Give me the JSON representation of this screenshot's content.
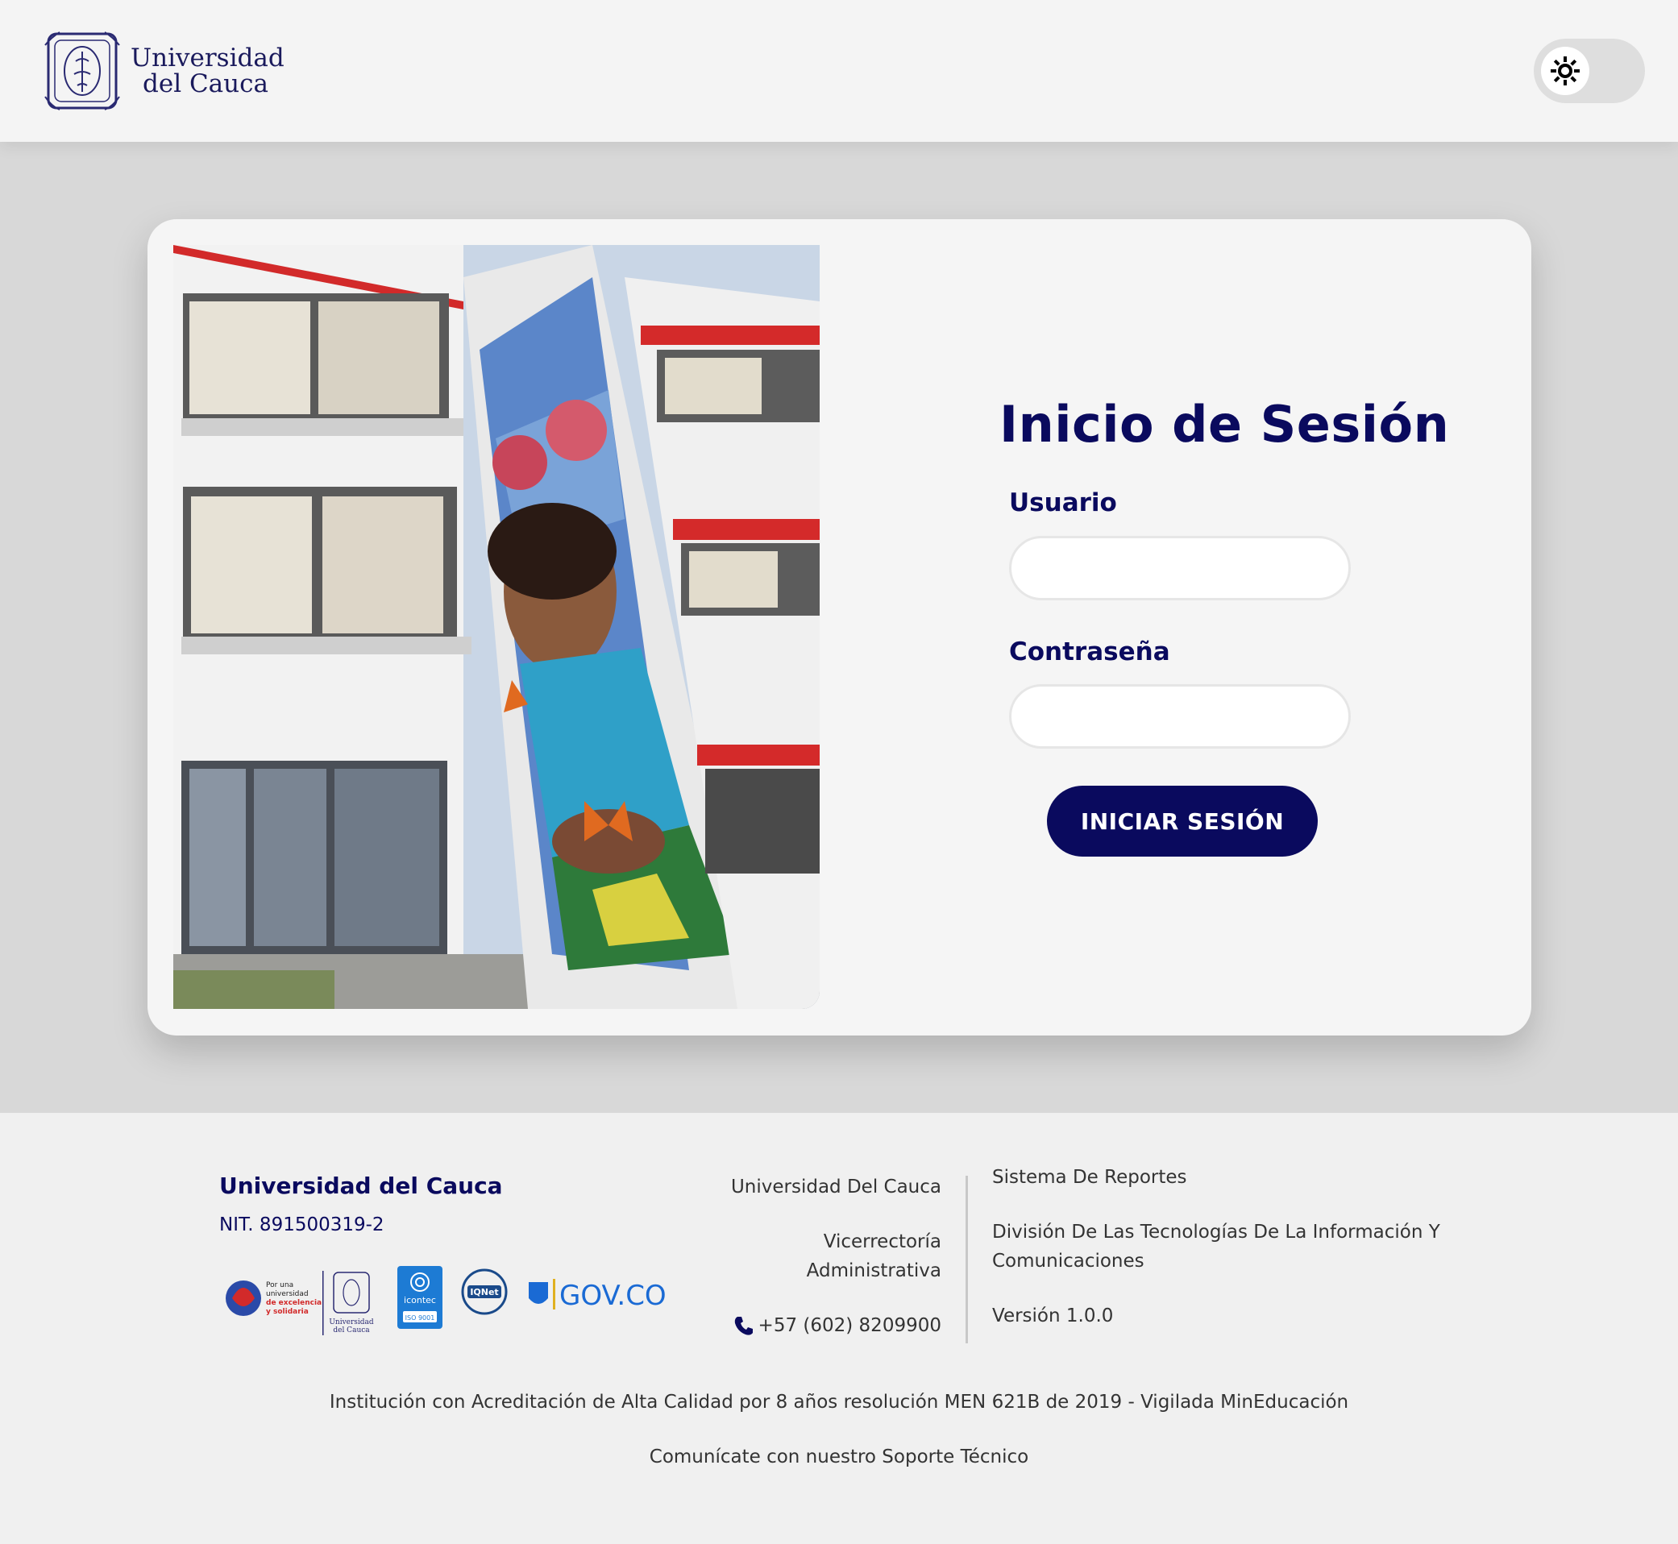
{
  "header": {
    "brand_line1": "Universidad",
    "brand_line2": "del Cauca",
    "theme_toggle_icon": "sun-icon"
  },
  "login": {
    "title": "Inicio de Sesión",
    "username_label": "Usuario",
    "username_value": "",
    "password_label": "Contraseña",
    "password_value": "",
    "submit_label": "INICIAR SESIÓN"
  },
  "footer": {
    "university": "Universidad del Cauca",
    "nit": "NIT. 891500319-2",
    "logos": {
      "logo1_line1": "Por una",
      "logo1_line2": "universidad",
      "logo1_line3": "de excelencia",
      "logo1_line4": "y solidaria",
      "logo2_line1": "Universidad",
      "logo2_line2": "del Cauca",
      "icontec": "icontec",
      "iso": "ISO 9001",
      "iqnet": "IQNet",
      "gov": "GOV.CO"
    },
    "middle": {
      "line1": "Universidad Del Cauca",
      "line2a": "Vicerrectoría",
      "line2b": "Administrativa",
      "phone": "+57 (602) 8209900"
    },
    "right": {
      "system": "Sistema De Reportes",
      "division": "División De Las Tecnologías De La Información Y Comunicaciones",
      "version": "Versión 1.0.0"
    },
    "accreditation": "Institución con Acreditación de Alta Calidad por 8 años resolución MEN 621B de 2019 - Vigilada MinEducación",
    "support": "Comunícate con nuestro Soporte Técnico"
  },
  "colors": {
    "primary": "#0a0a5e",
    "card_bg": "#f5f5f5",
    "page_bg": "#d8d8d8",
    "footer_bg": "#f0f0f0"
  }
}
